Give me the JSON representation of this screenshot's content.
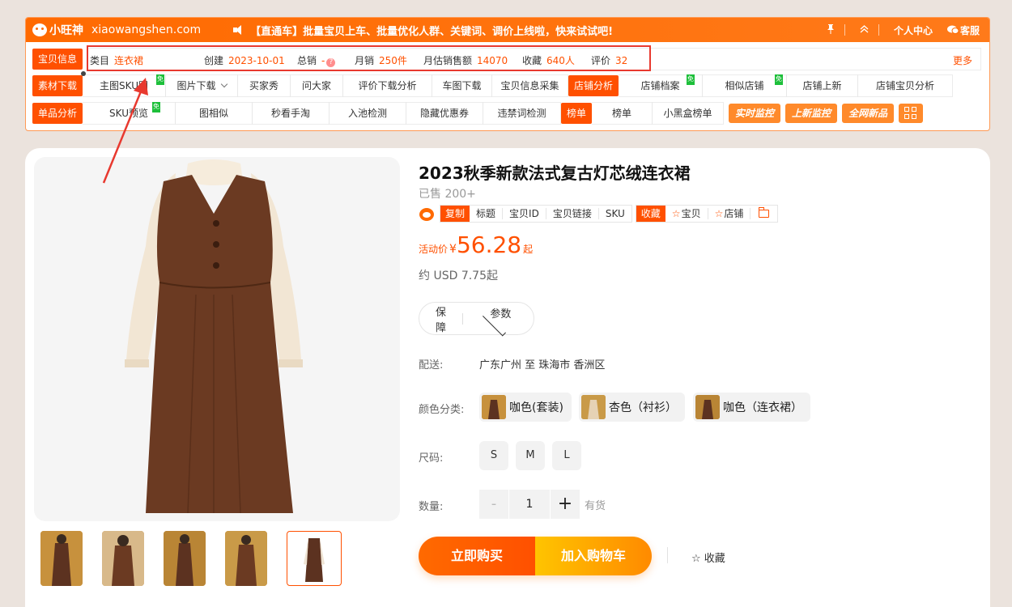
{
  "plugin": {
    "logo_name": "小旺神",
    "logo_url": "xiaowangshen.com",
    "announcement": "【直通车】批量宝贝上车、批量优化人群、关键词、调价上线啦，快来试试吧!",
    "top_right": {
      "pin_icon": "pin-icon",
      "collapse_icon": "chevron-up-icon",
      "personal_center": "个人中心",
      "support": "客服"
    },
    "row1": {
      "tag": "宝贝信息",
      "category_label": "类目",
      "category_value": "连衣裙",
      "created_label": "创建",
      "created_value": "2023-10-01",
      "total_sales_label": "总销",
      "total_sales_value": "-",
      "monthly_sales_label": "月销",
      "monthly_sales_value": "250件",
      "monthly_revenue_label": "月估销售额",
      "monthly_revenue_value": "14070",
      "favorites_label": "收藏",
      "favorites_value": "640人",
      "reviews_label": "评价",
      "reviews_value": "32",
      "more": "更多"
    },
    "row2": {
      "tag": "素材下载",
      "links": [
        "主图SKU图",
        "图片下载",
        "买家秀",
        "问大家",
        "评价下载分析",
        "车图下载",
        "宝贝信息采集"
      ],
      "shop_tag": "店铺分析",
      "shop_links": [
        "店铺档案",
        "相似店铺",
        "店铺上新",
        "店铺宝贝分析"
      ],
      "free_badge": "免"
    },
    "row3": {
      "tag": "单品分析",
      "links": [
        "SKU预览",
        "图相似",
        "秒看手淘",
        "入池检测",
        "隐藏优惠券",
        "违禁词检测"
      ],
      "rank_tag": "榜单",
      "rank_links": [
        "榜单",
        "小黑盒榜单"
      ],
      "pills": [
        "实时监控",
        "上新监控",
        "全网新品"
      ]
    }
  },
  "product": {
    "title": "2023秋季新款法式复古灯芯绒连衣裙",
    "sold": "已售 200+",
    "toolbar": {
      "copy": "复制",
      "copy_items": [
        "标题",
        "宝贝ID",
        "宝贝链接",
        "SKU"
      ],
      "collect": "收藏",
      "collect_item": "宝贝",
      "collect_shop": "店铺"
    },
    "price_label": "活动价",
    "price_currency": "¥",
    "price_value": "56.28",
    "price_suffix": "起",
    "usd": "约 USD 7.75起",
    "service": {
      "guarantee": "保障",
      "params": "参数"
    },
    "shipping_label": "配送:",
    "shipping_value": "广东广州 至 珠海市 香洲区",
    "color_label": "颜色分类:",
    "colors": [
      "咖色(套装)",
      "杏色（衬衫）",
      "咖色（连衣裙）"
    ],
    "size_label": "尺码:",
    "sizes": [
      "S",
      "M",
      "L"
    ],
    "qty_label": "数量:",
    "qty_minus": "-",
    "qty_value": "1",
    "qty_plus": "+",
    "stock": "有货",
    "buy_now": "立即购买",
    "add_cart": "加入购物车",
    "favorite": "收藏"
  },
  "colors": {
    "accent": "#ff5000",
    "brand": "#ff6a00",
    "highlight_box": "#e8392f",
    "free_badge": "#1dbf3a"
  }
}
